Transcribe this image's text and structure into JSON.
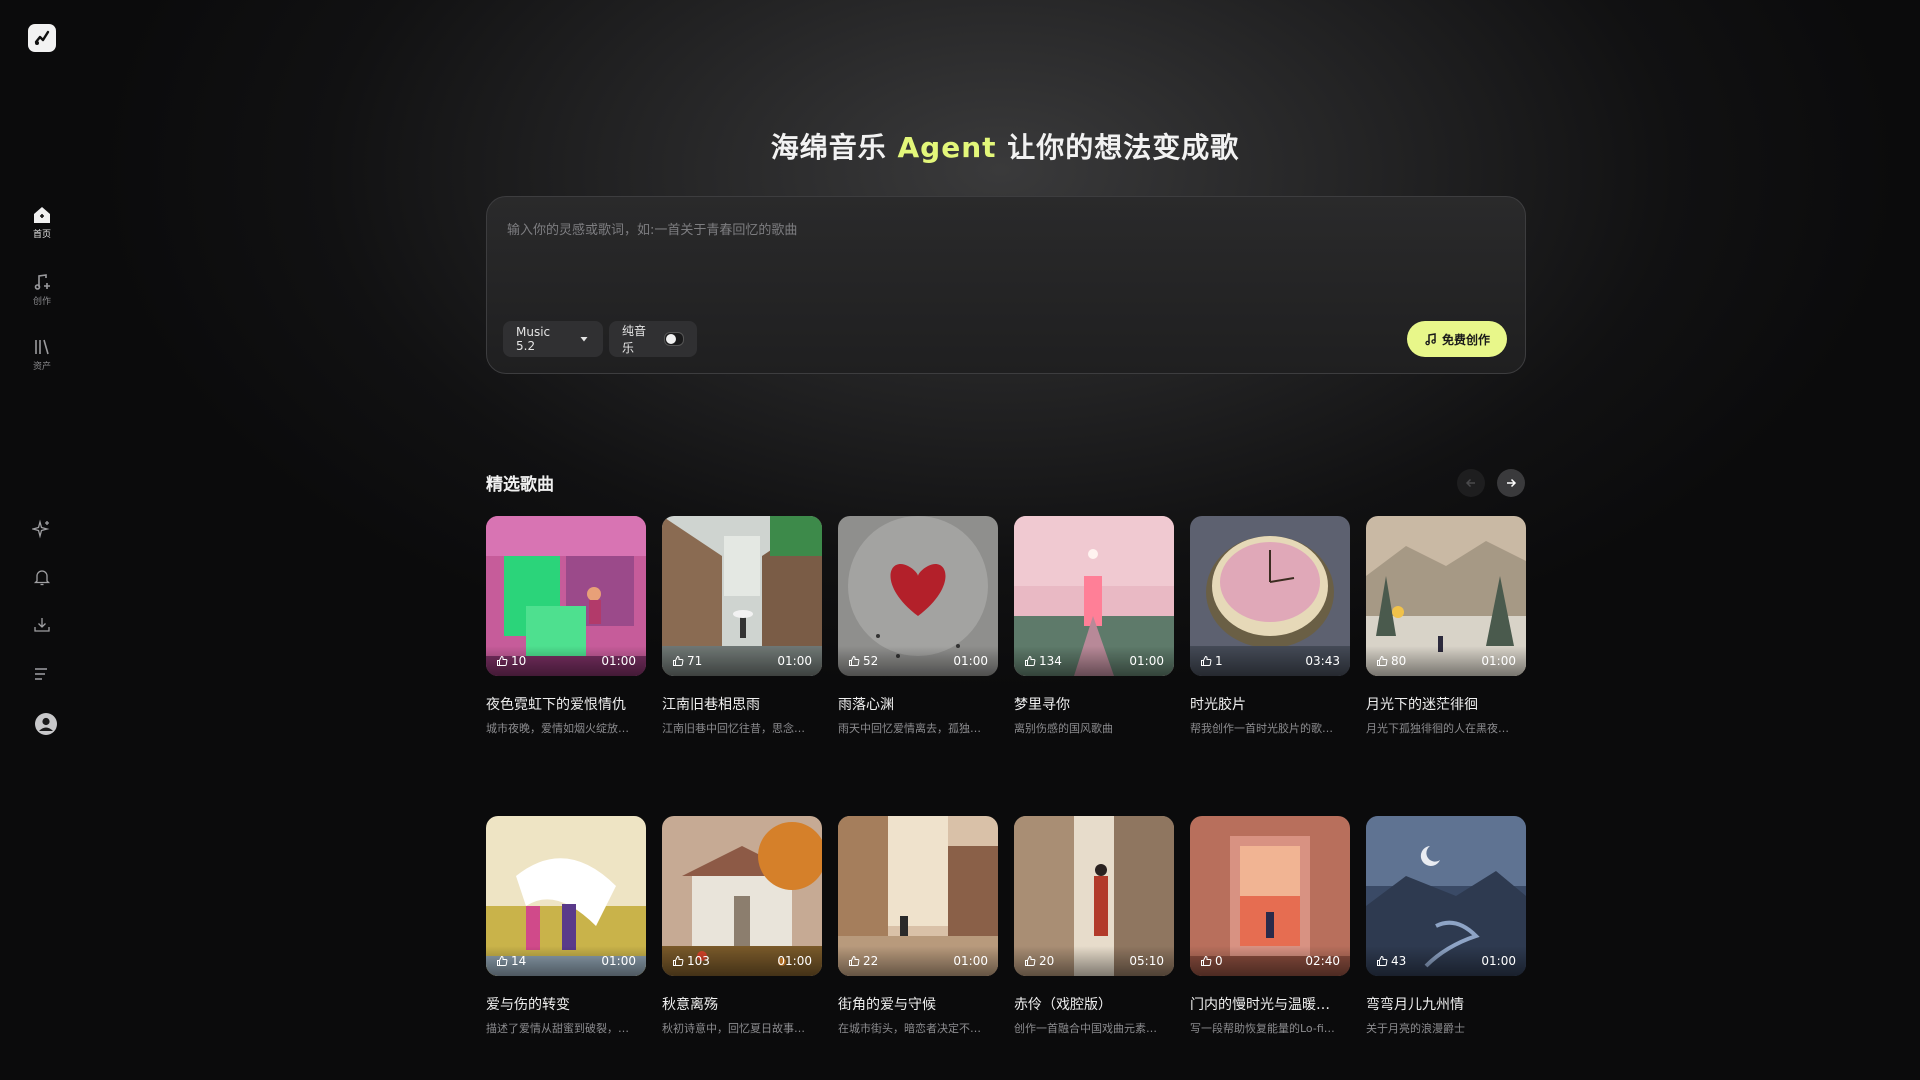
{
  "sidebar": {
    "nav": [
      {
        "label": "首页",
        "icon": "home-icon",
        "active": true
      },
      {
        "label": "创作",
        "icon": "music-note-plus-icon",
        "active": false
      },
      {
        "label": "资产",
        "icon": "library-icon",
        "active": false
      }
    ],
    "tools": [
      "sparkle-icon",
      "bell-icon",
      "download-icon",
      "list-icon",
      "user-avatar-icon"
    ]
  },
  "hero": {
    "title_part1": "海绵音乐 ",
    "title_accent": "Agent",
    "title_part2": " 让你的想法变成歌",
    "accent_color": "#e3f77a"
  },
  "prompt": {
    "placeholder": "输入你的灵感或歌词，如:一首关于青春回忆的歌曲",
    "value": "",
    "model_label": "Music 5.2",
    "pure_music_label": "纯音乐",
    "pure_music_on": false,
    "create_label": "免费创作"
  },
  "featured": {
    "title": "精选歌曲",
    "songs": [
      {
        "title": "夜色霓虹下的爱恨情仇",
        "desc": "城市夜晚，爱情如烟火绽放…",
        "likes": "10",
        "duration": "01:00"
      },
      {
        "title": "江南旧巷相思雨",
        "desc": "江南旧巷中回忆往昔，思念…",
        "likes": "71",
        "duration": "01:00"
      },
      {
        "title": "雨落心渊",
        "desc": "雨天中回忆爱情离去，孤独…",
        "likes": "52",
        "duration": "01:00"
      },
      {
        "title": "梦里寻你",
        "desc": "离别伤感的国风歌曲",
        "likes": "134",
        "duration": "01:00"
      },
      {
        "title": "时光胶片",
        "desc": "帮我创作一首时光胶片的歌…",
        "likes": "1",
        "duration": "03:43"
      },
      {
        "title": "月光下的迷茫徘徊",
        "desc": "月光下孤独徘徊的人在黑夜…",
        "likes": "80",
        "duration": "01:00"
      },
      {
        "title": "爱与伤的转变",
        "desc": "描述了爱情从甜蜜到破裂，…",
        "likes": "14",
        "duration": "01:00"
      },
      {
        "title": "秋意离殇",
        "desc": "秋初诗意中，回忆夏日故事…",
        "likes": "103",
        "duration": "01:00"
      },
      {
        "title": "街角的爱与守候",
        "desc": "在城市街头，暗恋者决定不…",
        "likes": "22",
        "duration": "01:00"
      },
      {
        "title": "赤伶（戏腔版）",
        "desc": "创作一首融合中国戏曲元素…",
        "likes": "20",
        "duration": "05:10"
      },
      {
        "title": "门内的慢时光与温暖…",
        "desc": "写一段帮助恢复能量的Lo-fi…",
        "likes": "0",
        "duration": "02:40"
      },
      {
        "title": "弯弯月儿九州情",
        "desc": "关于月亮的浪漫爵士",
        "likes": "43",
        "duration": "01:00"
      }
    ]
  }
}
